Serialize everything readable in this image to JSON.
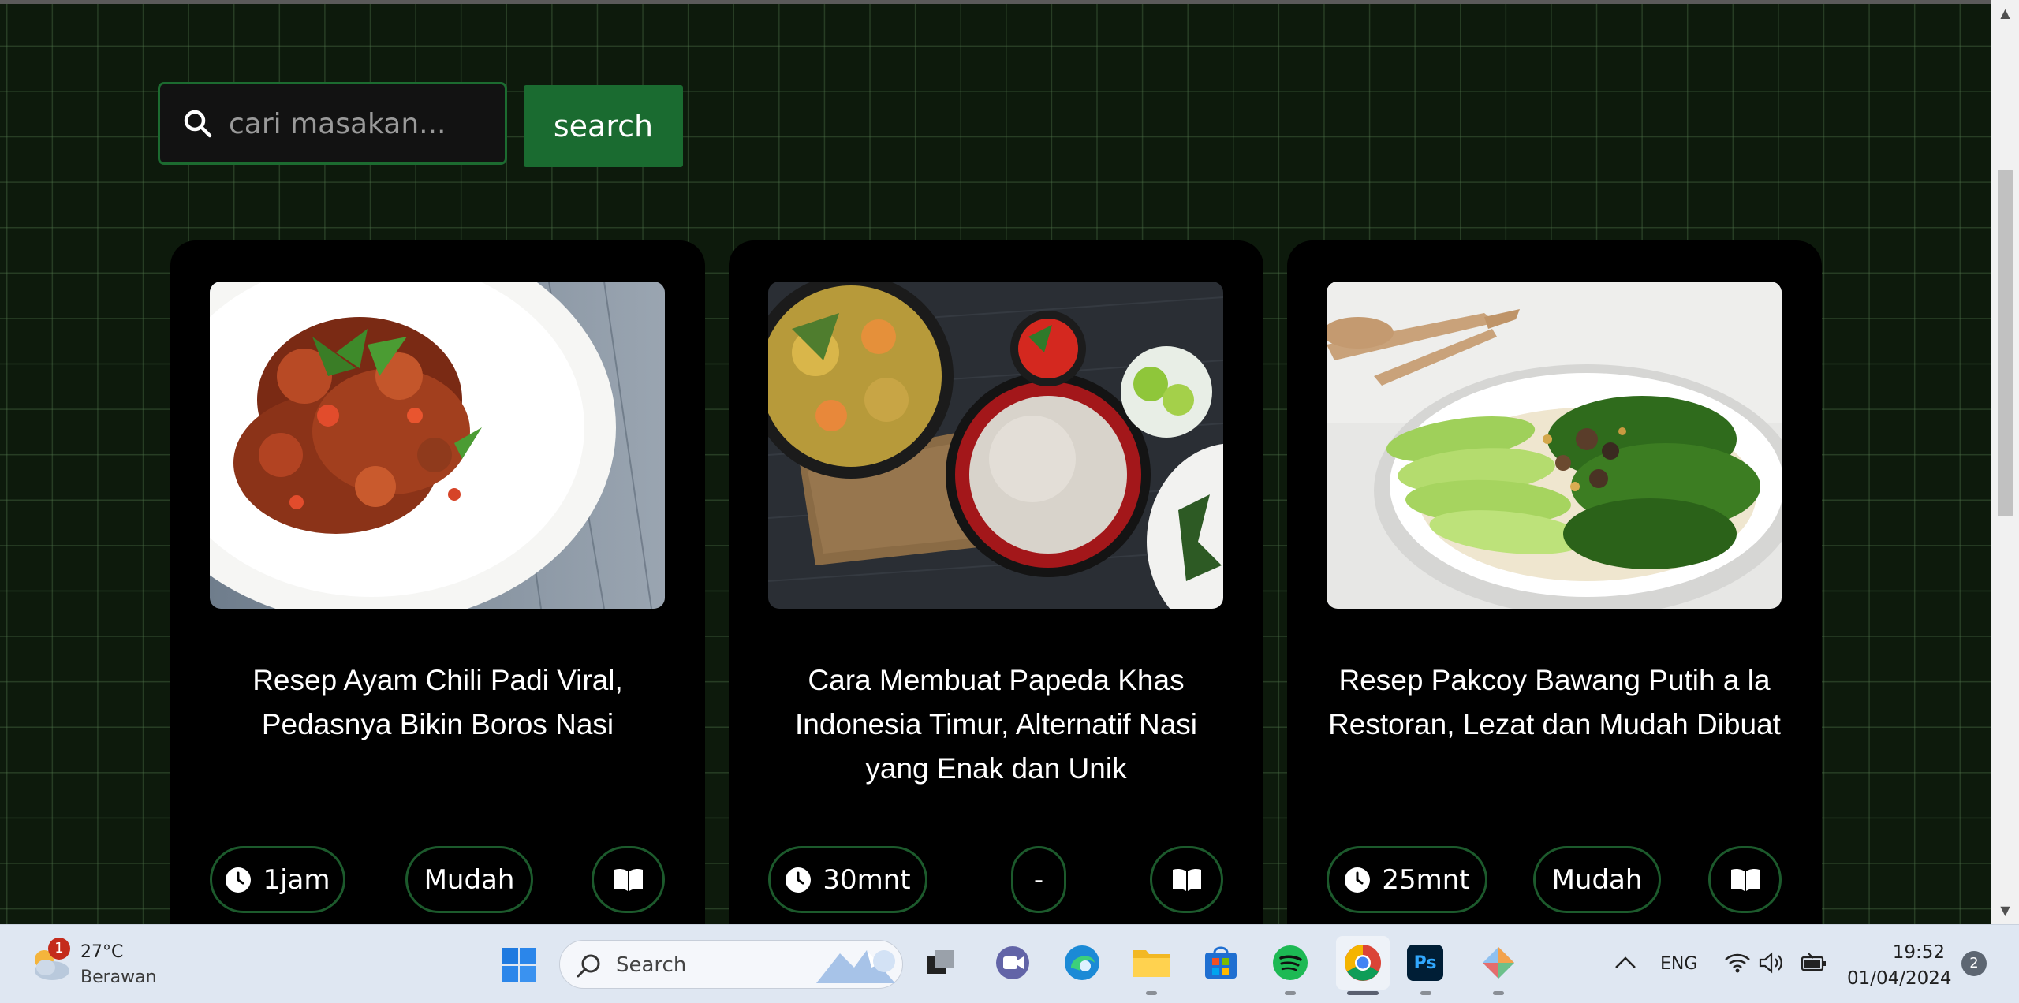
{
  "search": {
    "placeholder": "cari masakan...",
    "button_label": "search"
  },
  "cards": [
    {
      "title": "Resep Ayam Chili Padi Viral, Pedasnya Bikin Boros Nasi",
      "time": "1jam",
      "difficulty": "Mudah",
      "image_icon": "chili-chicken-photo"
    },
    {
      "title": "Cara Membuat Papeda Khas Indonesia Timur, Alternatif Nasi yang Enak dan Unik",
      "time": "30mnt",
      "difficulty": "-",
      "image_icon": "papeda-photo"
    },
    {
      "title": "Resep Pakcoy Bawang Putih a la Restoran, Lezat dan Mudah Dibuat",
      "time": "25mnt",
      "difficulty": "Mudah",
      "image_icon": "pakcoy-photo"
    }
  ],
  "taskbar": {
    "weather_temp": "27°C",
    "weather_desc": "Berawan",
    "weather_badge": "1",
    "search_label": "Search",
    "language": "ENG",
    "time": "19:52",
    "date": "01/04/2024",
    "notification_count": "2"
  },
  "colors": {
    "page_bg": "#0d1a0c",
    "accent_green": "#1a6b30",
    "card_bg": "#000000",
    "pill_border": "#1c5a2c"
  }
}
